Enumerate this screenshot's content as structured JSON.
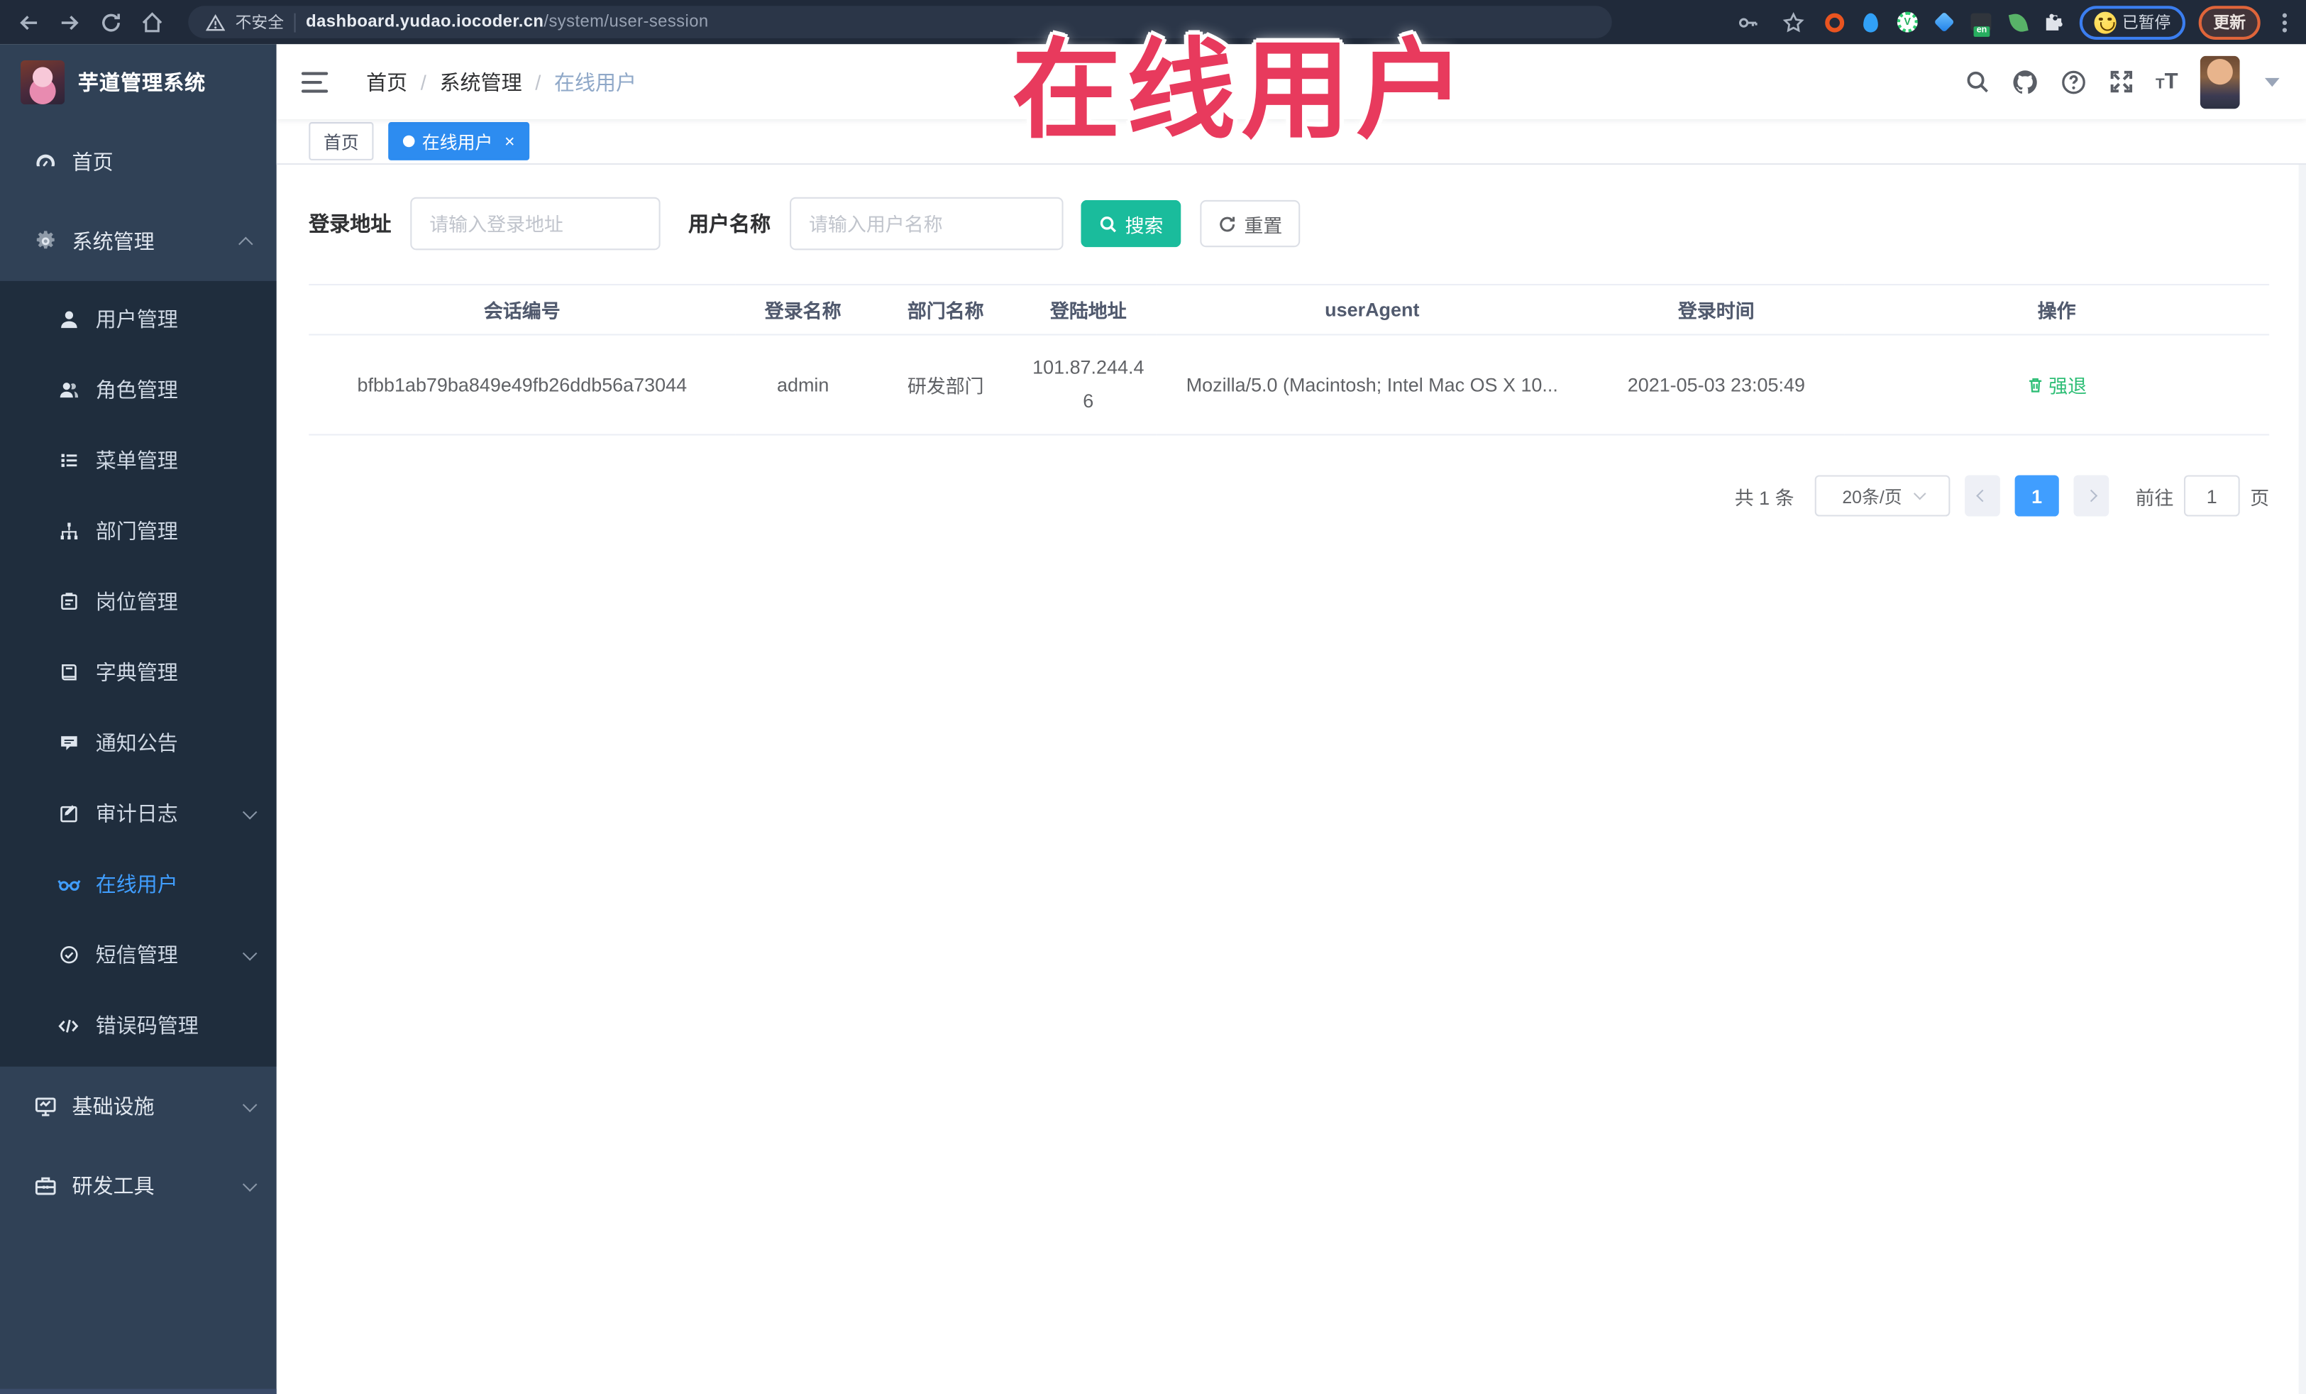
{
  "browser": {
    "not_secure": "不安全",
    "url_host": "dashboard.yudao.iocoder.cn",
    "url_path": "/system/user-session",
    "paused_label": "已暂停",
    "update_label": "更新"
  },
  "logo": {
    "title": "芋道管理系统"
  },
  "sidebar": {
    "items": [
      {
        "label": "首页"
      },
      {
        "label": "系统管理"
      },
      {
        "label": "用户管理"
      },
      {
        "label": "角色管理"
      },
      {
        "label": "菜单管理"
      },
      {
        "label": "部门管理"
      },
      {
        "label": "岗位管理"
      },
      {
        "label": "字典管理"
      },
      {
        "label": "通知公告"
      },
      {
        "label": "审计日志"
      },
      {
        "label": "在线用户"
      },
      {
        "label": "短信管理"
      },
      {
        "label": "错误码管理"
      },
      {
        "label": "基础设施"
      },
      {
        "label": "研发工具"
      }
    ]
  },
  "breadcrumb": {
    "items": [
      "首页",
      "系统管理",
      "在线用户"
    ]
  },
  "tags": {
    "items": [
      "首页",
      "在线用户"
    ]
  },
  "overlay": {
    "title": "在线用户"
  },
  "search": {
    "addr_label": "登录地址",
    "addr_placeholder": "请输入登录地址",
    "name_label": "用户名称",
    "name_placeholder": "请输入用户名称",
    "search_label": "搜索",
    "reset_label": "重置"
  },
  "table": {
    "headers": [
      "会话编号",
      "登录名称",
      "部门名称",
      "登陆地址",
      "userAgent",
      "登录时间",
      "操作"
    ],
    "row": {
      "session_id": "bfbb1ab79ba849e49fb26ddb56a73044",
      "username": "admin",
      "dept": "研发部门",
      "ip": "101.87.244.46",
      "user_agent": "Mozilla/5.0 (Macintosh; Intel Mac OS X 10...",
      "login_time": "2021-05-03 23:05:49",
      "action": "强退"
    }
  },
  "pagination": {
    "total": "共 1 条",
    "page_size": "20条/页",
    "current": "1",
    "goto_label": "前往",
    "goto_value": "1",
    "unit": "页"
  },
  "colors": {
    "accent": "#409eff",
    "tag_active": "#2d8cf0",
    "search_button": "#1abc9c",
    "action_green": "#2ebe76",
    "annotation_red": "#e83a5d",
    "sidebar_bg": "#304156",
    "submenu_bg": "#1f2d3d"
  }
}
